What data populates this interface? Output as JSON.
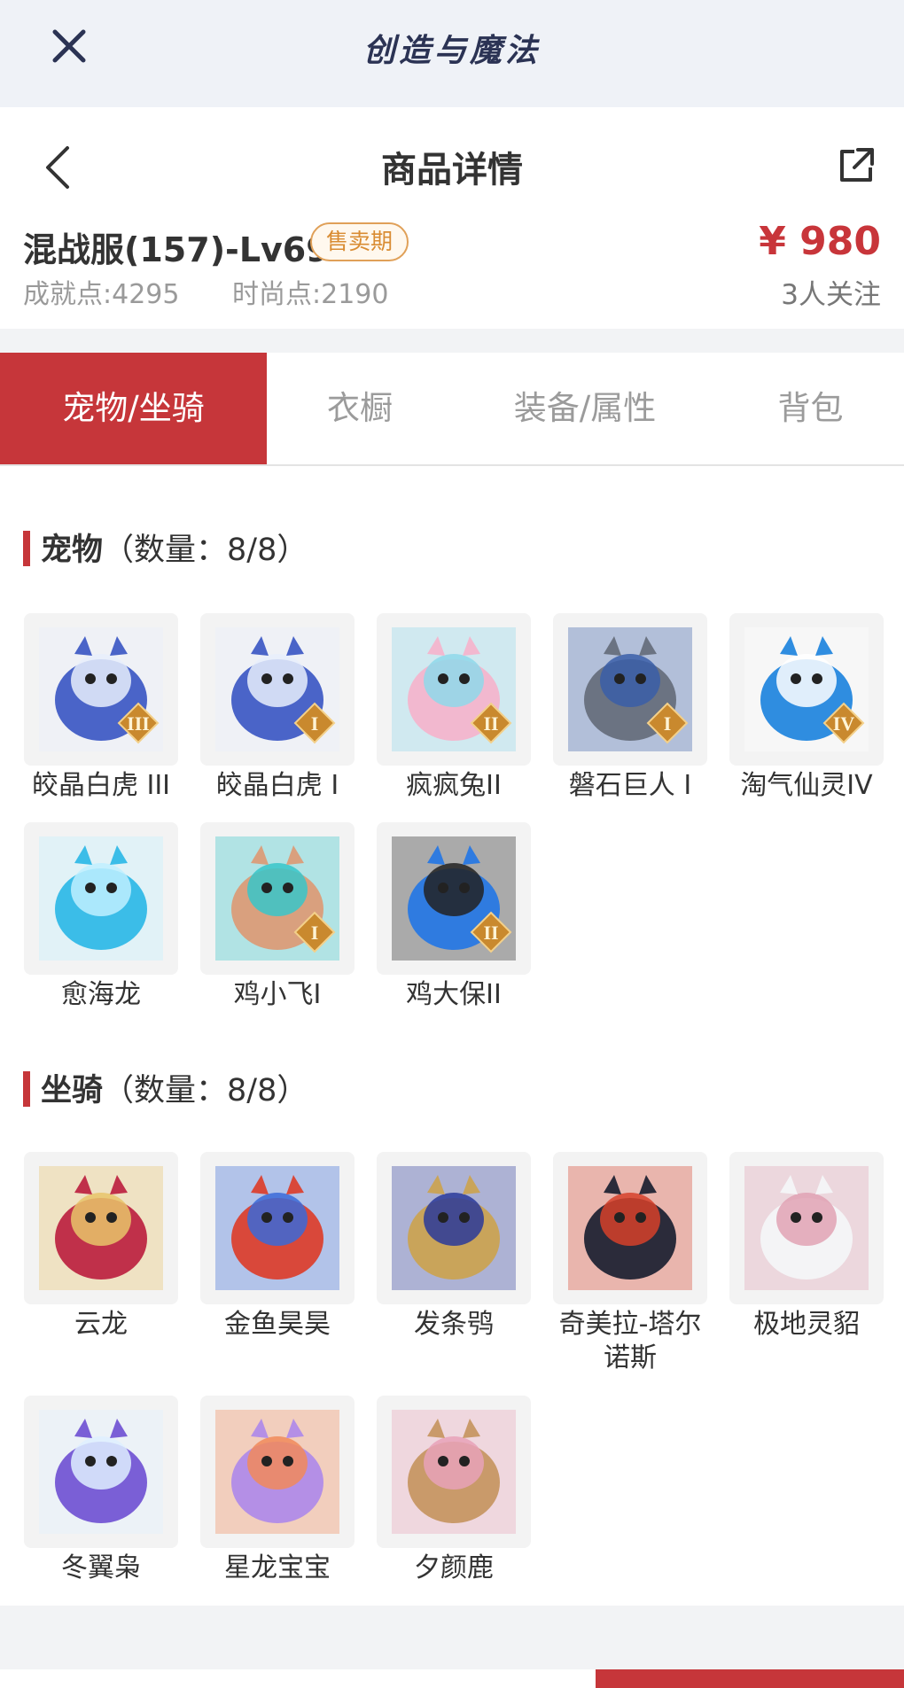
{
  "app_bar": {
    "title": "创造与魔法",
    "close_icon": "close-icon"
  },
  "nav": {
    "title": "商品详情",
    "back_icon": "chevron-left-icon",
    "share_icon": "share-icon"
  },
  "summary": {
    "name": "混战服(157)-Lv69",
    "status_badge": "售卖期",
    "achievement": "成就点:4295",
    "fashion": "时尚点:2190",
    "price": "¥ 980",
    "followers": "3人关注"
  },
  "tabs": [
    {
      "label": "宠物/坐骑",
      "active": true
    },
    {
      "label": "衣橱",
      "active": false
    },
    {
      "label": "装备/属性",
      "active": false
    },
    {
      "label": "背包",
      "active": false
    }
  ],
  "pets": {
    "title": "宠物",
    "count": "（数量：8/8）",
    "items": [
      {
        "name": "皎晶白虎 III",
        "tier": "III",
        "color": "#4a64c8",
        "accent": "#e8eefc"
      },
      {
        "name": "皎晶白虎 I",
        "tier": "I",
        "color": "#4a64c8",
        "accent": "#e8eefc"
      },
      {
        "name": "疯疯兔II",
        "tier": "II",
        "color": "#f2b8cf",
        "accent": "#8fd8ea"
      },
      {
        "name": "磐石巨人 I",
        "tier": "I",
        "color": "#6b7382",
        "accent": "#3a5ea8"
      },
      {
        "name": "淘气仙灵IV",
        "tier": "IV",
        "color": "#2f8de0",
        "accent": "#ffffff"
      },
      {
        "name": "愈海龙",
        "tier": "",
        "color": "#3bbde8",
        "accent": "#bff0ff"
      },
      {
        "name": "鸡小飞I",
        "tier": "I",
        "color": "#d9a07e",
        "accent": "#37c6c9"
      },
      {
        "name": "鸡大保II",
        "tier": "II",
        "color": "#2f7be0",
        "accent": "#222222"
      }
    ]
  },
  "mounts": {
    "title": "坐骑",
    "count": "（数量：8/8）",
    "items": [
      {
        "name": "云龙",
        "tier": "",
        "color": "#c0304a",
        "accent": "#e7c46a"
      },
      {
        "name": "金鱼昊昊",
        "tier": "",
        "color": "#d9483a",
        "accent": "#3a6ad8"
      },
      {
        "name": "发条鸮",
        "tier": "",
        "color": "#c9a45a",
        "accent": "#2a3a9a"
      },
      {
        "name": "奇美拉-塔尔诺斯",
        "tier": "",
        "color": "#2b2b3a",
        "accent": "#d6412a"
      },
      {
        "name": "极地灵貂",
        "tier": "",
        "color": "#f4f4f6",
        "accent": "#e0a2b4"
      },
      {
        "name": "冬翼枭",
        "tier": "",
        "color": "#7a5fd6",
        "accent": "#dff0ff"
      },
      {
        "name": "星龙宝宝",
        "tier": "",
        "color": "#b48fe6",
        "accent": "#f18a5a"
      },
      {
        "name": "夕颜鹿",
        "tier": "",
        "color": "#c99a6a",
        "accent": "#e8a2b8"
      }
    ]
  }
}
